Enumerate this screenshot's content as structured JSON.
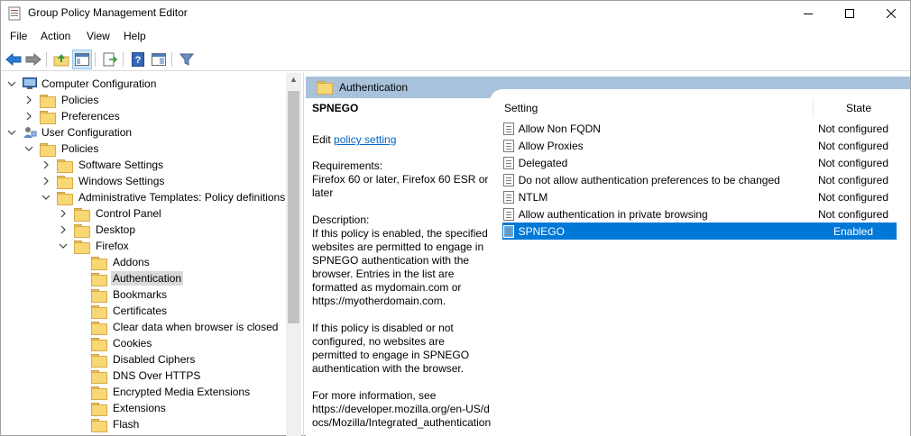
{
  "window": {
    "title": "Group Policy Management Editor"
  },
  "menu": [
    "File",
    "Action",
    "View",
    "Help"
  ],
  "tree": [
    {
      "label": "Computer Configuration",
      "level": 0,
      "expanded": true,
      "icon": "computer-icon"
    },
    {
      "label": "Policies",
      "level": 1,
      "expanded": false,
      "icon": "folder-icon"
    },
    {
      "label": "Preferences",
      "level": 1,
      "expanded": false,
      "icon": "folder-icon"
    },
    {
      "label": "User Configuration",
      "level": 0,
      "expanded": true,
      "icon": "user-icon"
    },
    {
      "label": "Policies",
      "level": 1,
      "expanded": true,
      "icon": "folder-icon"
    },
    {
      "label": "Software Settings",
      "level": 2,
      "expanded": false,
      "icon": "folder-icon"
    },
    {
      "label": "Windows Settings",
      "level": 2,
      "expanded": false,
      "icon": "folder-icon"
    },
    {
      "label": "Administrative Templates: Policy definitions",
      "level": 2,
      "expanded": true,
      "icon": "folder-icon"
    },
    {
      "label": "Control Panel",
      "level": 3,
      "expanded": false,
      "icon": "folder-icon"
    },
    {
      "label": "Desktop",
      "level": 3,
      "expanded": false,
      "icon": "folder-icon"
    },
    {
      "label": "Firefox",
      "level": 3,
      "expanded": true,
      "icon": "folder-icon"
    },
    {
      "label": "Addons",
      "level": 4,
      "icon": "folder-icon"
    },
    {
      "label": "Authentication",
      "level": 4,
      "icon": "folder-icon",
      "selected": true
    },
    {
      "label": "Bookmarks",
      "level": 4,
      "icon": "folder-icon"
    },
    {
      "label": "Certificates",
      "level": 4,
      "icon": "folder-icon"
    },
    {
      "label": "Clear data when browser is closed",
      "level": 4,
      "icon": "folder-icon"
    },
    {
      "label": "Cookies",
      "level": 4,
      "icon": "folder-icon"
    },
    {
      "label": "Disabled Ciphers",
      "level": 4,
      "icon": "folder-icon"
    },
    {
      "label": "DNS Over HTTPS",
      "level": 4,
      "icon": "folder-icon"
    },
    {
      "label": "Encrypted Media Extensions",
      "level": 4,
      "icon": "folder-icon"
    },
    {
      "label": "Extensions",
      "level": 4,
      "icon": "folder-icon"
    },
    {
      "label": "Flash",
      "level": 4,
      "icon": "folder-icon"
    }
  ],
  "panel": {
    "header": "Authentication",
    "policy_name": "SPNEGO",
    "edit_prefix": "Edit ",
    "edit_link": "policy setting",
    "requirements_label": "Requirements:",
    "requirements": "Firefox 60 or later, Firefox 60 ESR or later",
    "description_label": "Description:",
    "description_1": "If this policy is enabled, the specified websites are permitted to engage in SPNEGO authentication with the browser. Entries in the list are formatted as mydomain.com or https://myotherdomain.com.",
    "description_2": "If this policy is disabled or not configured, no websites are permitted to engage in SPNEGO authentication with the browser.",
    "more_info_label": "For more information, see",
    "more_info_url": "https://developer.mozilla.org/en-US/docs/Mozilla/Integrated_authentication"
  },
  "list": {
    "col_setting": "Setting",
    "col_state": "State",
    "rows": [
      {
        "name": "Allow Non FQDN",
        "state": "Not configured"
      },
      {
        "name": "Allow Proxies",
        "state": "Not configured"
      },
      {
        "name": "Delegated",
        "state": "Not configured"
      },
      {
        "name": "Do not allow authentication preferences to be changed",
        "state": "Not configured"
      },
      {
        "name": "NTLM",
        "state": "Not configured"
      },
      {
        "name": "Allow authentication in private browsing",
        "state": "Not configured"
      },
      {
        "name": "SPNEGO",
        "state": "Enabled",
        "selected": true
      }
    ]
  },
  "colors": {
    "accent": "#0078d7",
    "header_band": "#a8c2dc",
    "folder": "#f8d775"
  }
}
